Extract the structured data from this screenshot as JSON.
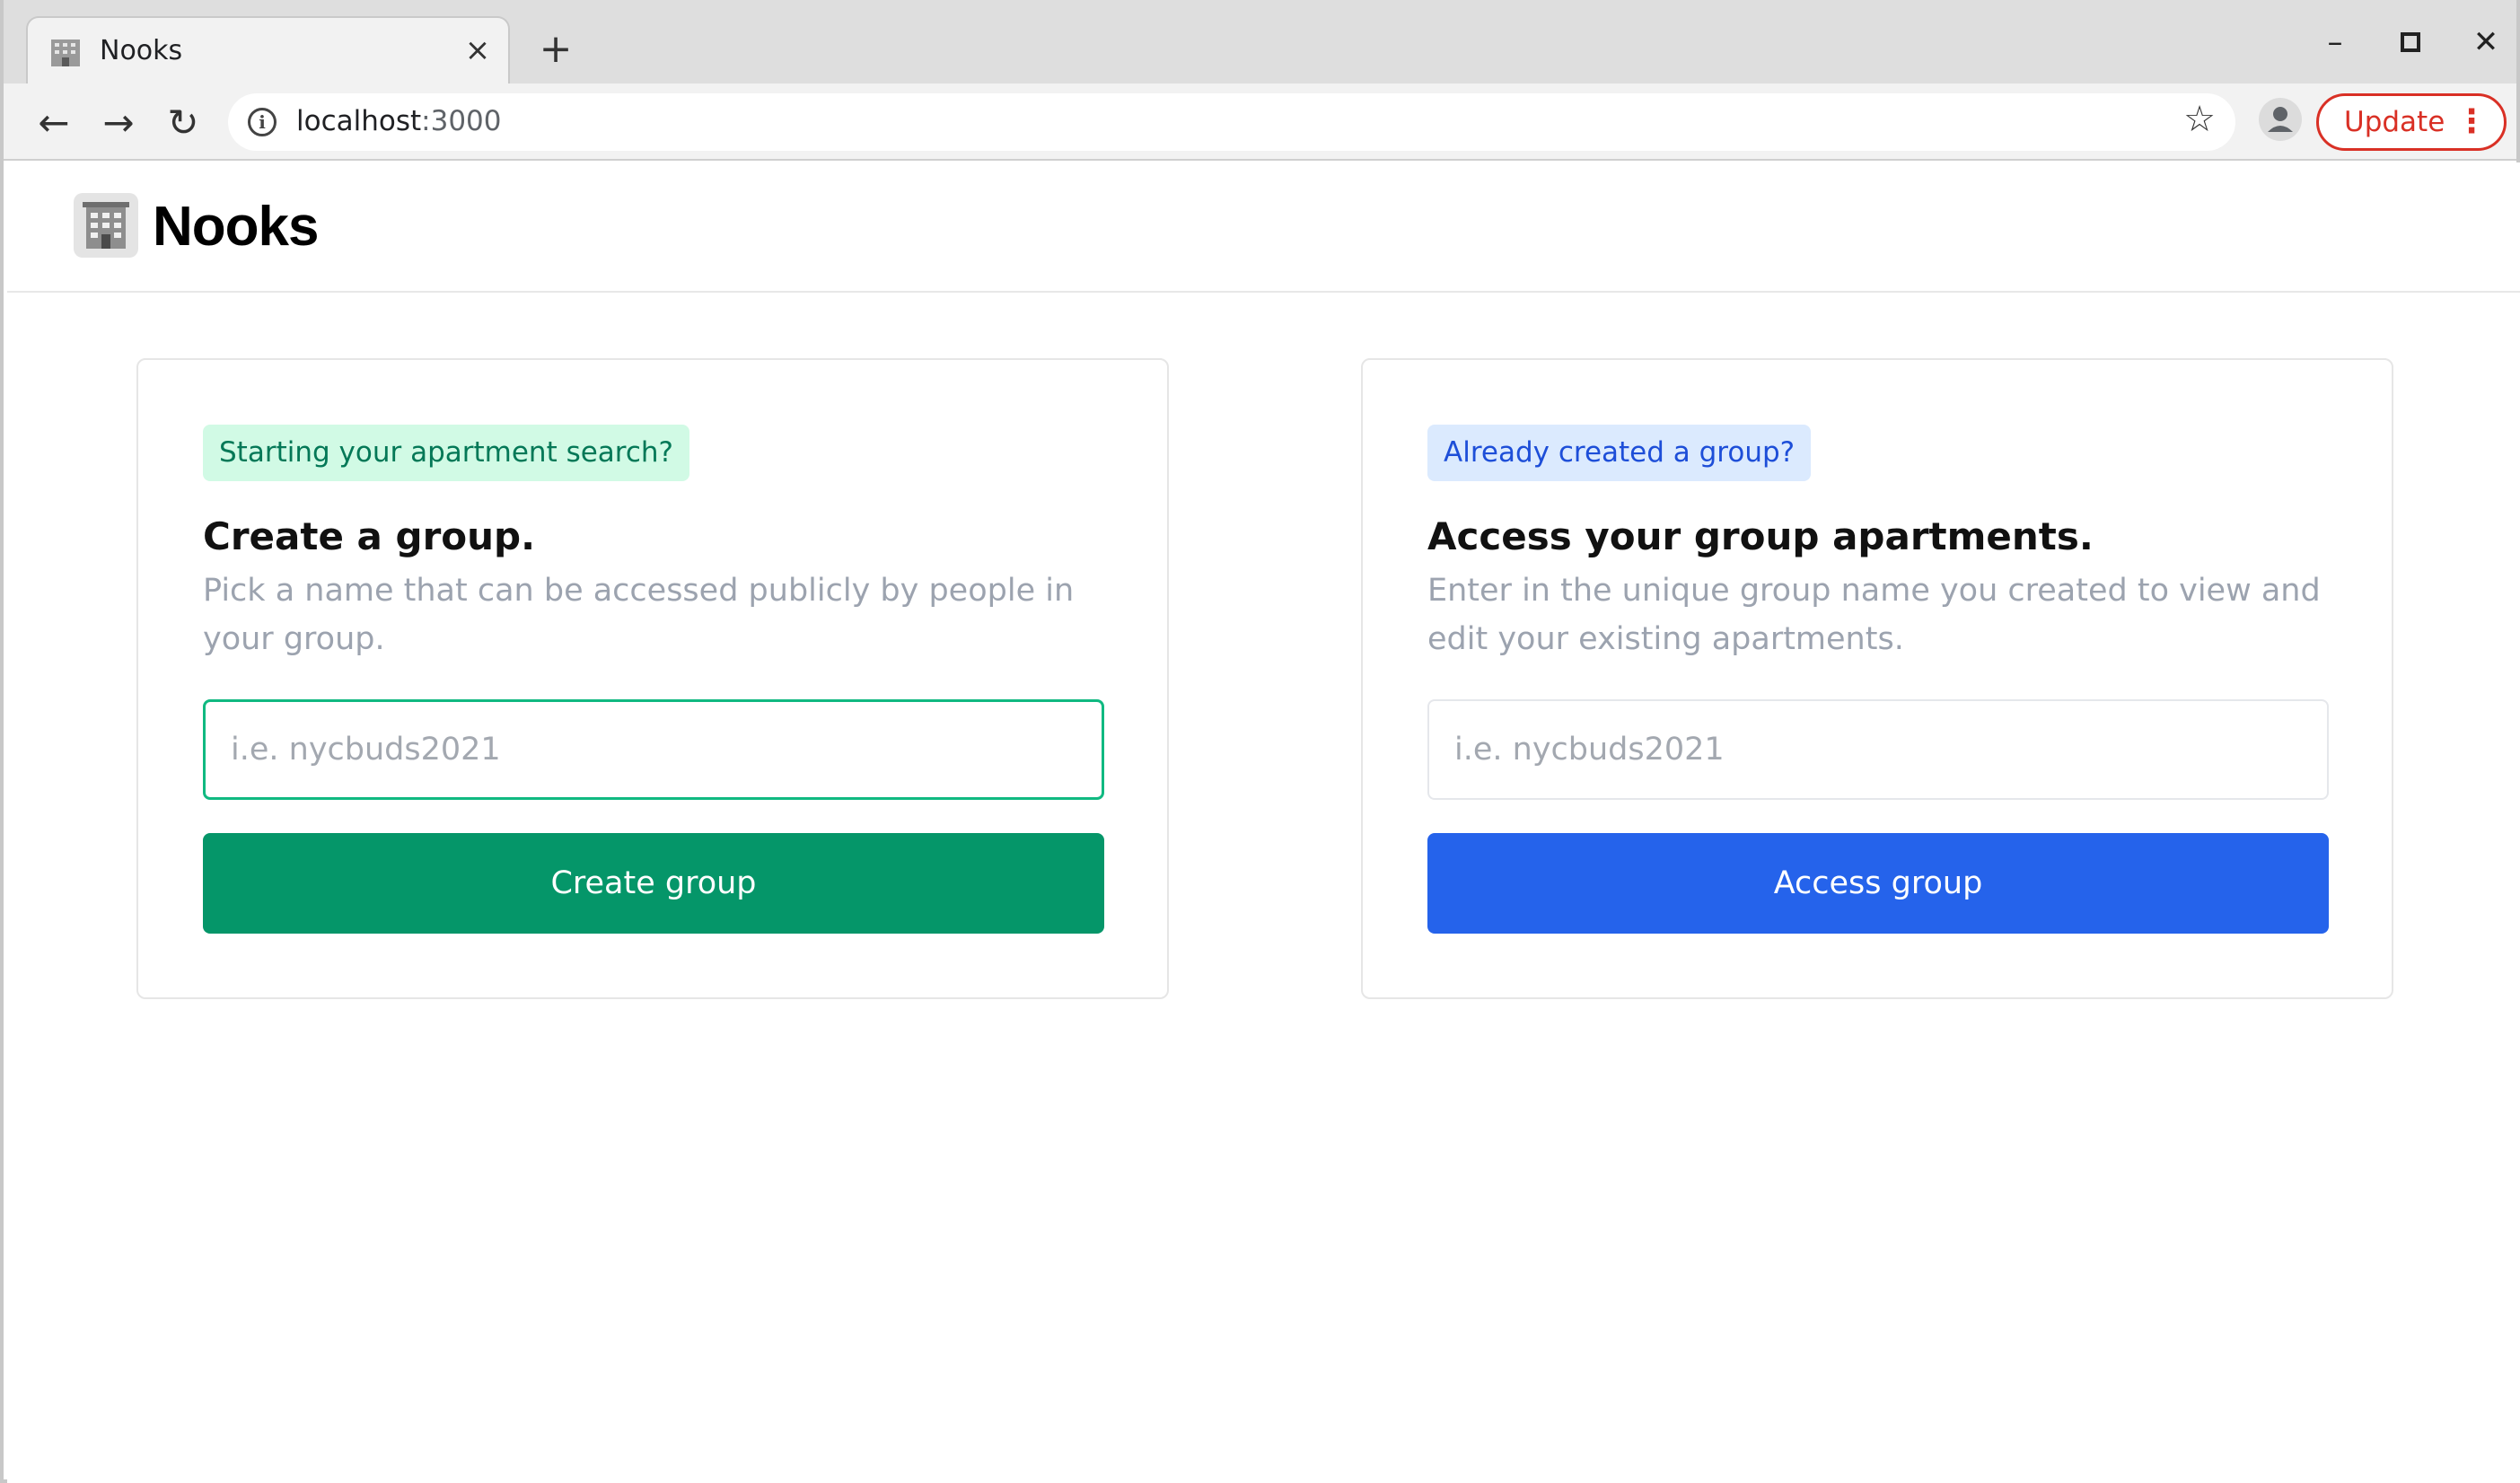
{
  "browser": {
    "tab_title": "Nooks",
    "tab_close": "×",
    "new_tab": "+",
    "window_controls": {
      "minimize": "–",
      "maximize": "▫",
      "close": "✕"
    },
    "nav": {
      "back": "←",
      "forward": "→",
      "reload": "↻"
    },
    "url_host": "localhost",
    "url_port": ":3000",
    "info_icon": "i",
    "star_icon": "☆",
    "update_label": "Update",
    "menu_dots": "⋮"
  },
  "site": {
    "logo_text": "Nooks"
  },
  "create_card": {
    "badge": "Starting your apartment search?",
    "title": "Create a group.",
    "description": "Pick a name that can be accessed publicly by people in your group.",
    "input_placeholder": "i.e. nycbuds2021",
    "input_value": "",
    "button_label": "Create group"
  },
  "access_card": {
    "badge": "Already created a group?",
    "title": "Access your group apartments.",
    "description": "Enter in the unique group name you created to view and edit your existing apartments.",
    "input_placeholder": "i.e. nycbuds2021",
    "input_value": "",
    "button_label": "Access group"
  },
  "colors": {
    "green_accent": "#059669",
    "blue_accent": "#2563eb",
    "update_red": "#d93025"
  }
}
